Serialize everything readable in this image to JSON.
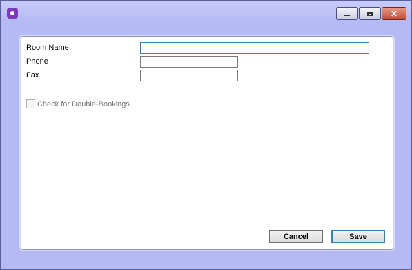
{
  "form": {
    "room_name_label": "Room Name",
    "room_name_value": "",
    "phone_label": "Phone",
    "phone_value": "",
    "fax_label": "Fax",
    "fax_value": "",
    "double_booking_label": "Check for Double-Bookings",
    "double_booking_checked": false
  },
  "buttons": {
    "cancel_label": "Cancel",
    "save_label": "Save"
  },
  "colors": {
    "window_bg": "#b6baf4",
    "focus_border": "#3c7fb1"
  },
  "icons": {
    "app": "app-icon",
    "minimize": "minimize-icon",
    "maximize": "maximize-icon",
    "close": "close-icon",
    "resize": "resize-grip-icon"
  }
}
